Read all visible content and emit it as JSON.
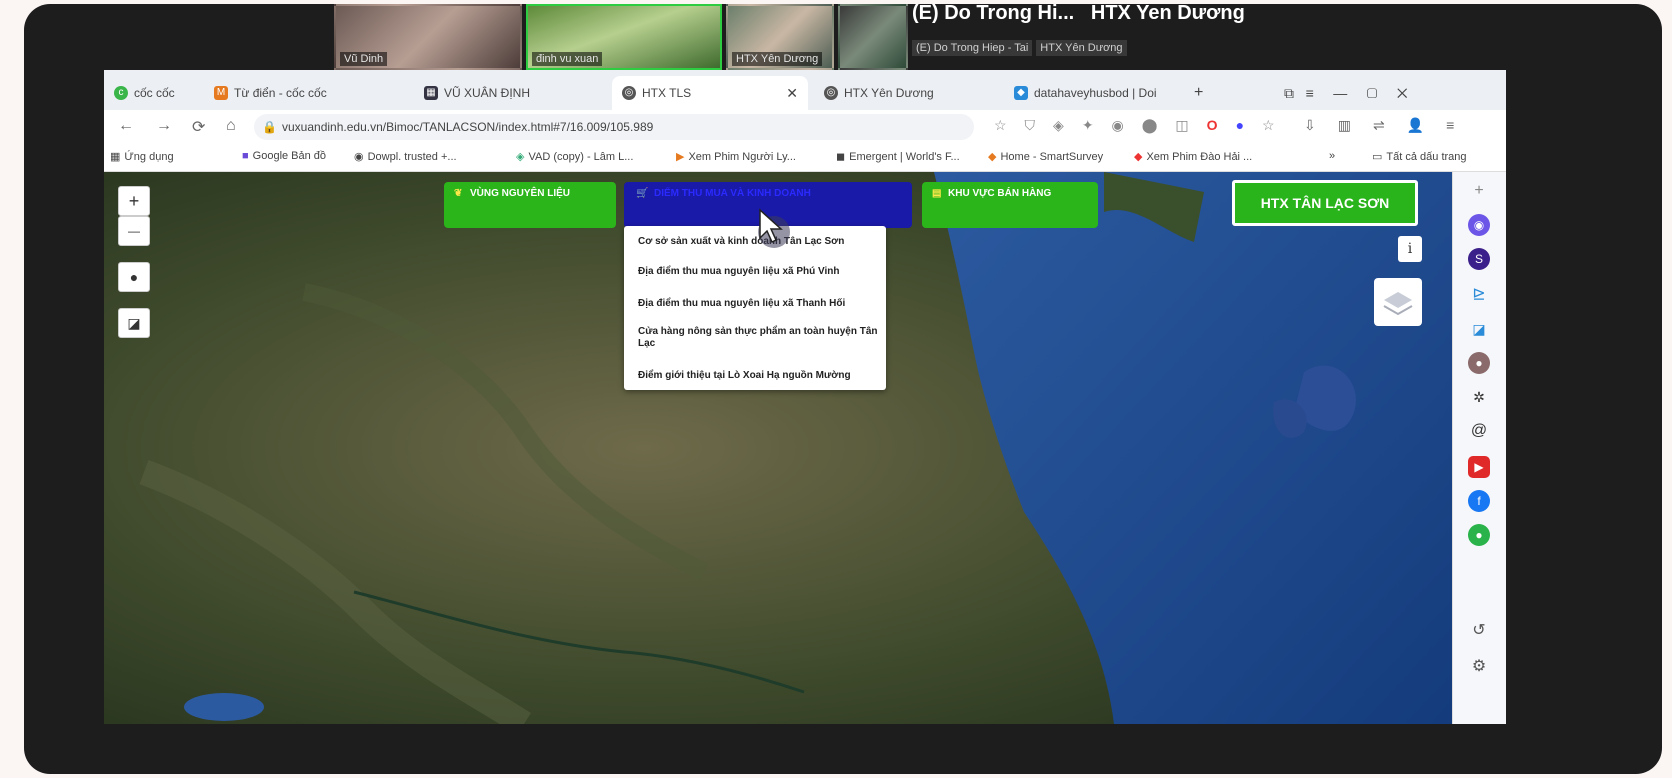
{
  "video_call": {
    "tiles": [
      {
        "label": "Vũ Dinh"
      },
      {
        "label": "đinh vu xuan"
      },
      {
        "label": "HTX Yên Dương"
      }
    ],
    "speaker_name": "(E) Do Trong Hi...",
    "speaker_org": "HTX Yen Dương",
    "participants": [
      "(E) Do Trong Hiep - Tai",
      "HTX Yên Dương"
    ]
  },
  "browser": {
    "brand": "cốc cốc",
    "tabs": [
      {
        "label": "Từ điển - cốc cốc",
        "active": false
      },
      {
        "label": "VŨ XUÂN ĐỊNH",
        "active": false
      },
      {
        "label": "HTX TLS",
        "active": true
      },
      {
        "label": "HTX Yên Dương",
        "active": false
      },
      {
        "label": "datahaveyhusbod | Doi",
        "active": false
      }
    ],
    "url": "vuxuandinh.edu.vn/Bimoc/TANLACSON/index.html#7/16.009/105.989",
    "bookmarks": [
      "Ứng dụng",
      "Google Bản đồ",
      "Dowpl. trusted +...",
      "VAD (copy) - Lâm L...",
      "Xem Phim Người Ly...",
      "Emergent | World's F...",
      "Home - SmartSurvey",
      "Xem Phim Đào Hải ...",
      "Tất cả dấu trang"
    ]
  },
  "map": {
    "buttons": {
      "vung_nguyen_lieu": "VÙNG NGUYÊN LIỆU",
      "dropdown_btn": "DIỂM THU MUA VÀ KINH DOANH",
      "khu_vuc_ban_hang": "KHU VỰC BÁN HÀNG",
      "htx": "HTX TÂN LẠC SƠN"
    },
    "dropdown_items": [
      "Cơ sở sản xuất và kinh doanh Tân Lạc Sơn",
      "Địa điểm thu mua nguyên liệu xã Phú Vinh",
      "Địa điểm thu mua nguyên liệu xã Thanh Hối",
      "Cửa hàng nông sản thực phẩm an toàn huyện Tân Lạc",
      "Điểm giới thiệu tại Lò Xoai Hạ nguồn Mường"
    ],
    "controls": {
      "zoom_in": "+",
      "zoom_out": "—",
      "info": "i"
    }
  },
  "colors": {
    "green": "#2bb51a",
    "blue": "#1a1aa8"
  }
}
